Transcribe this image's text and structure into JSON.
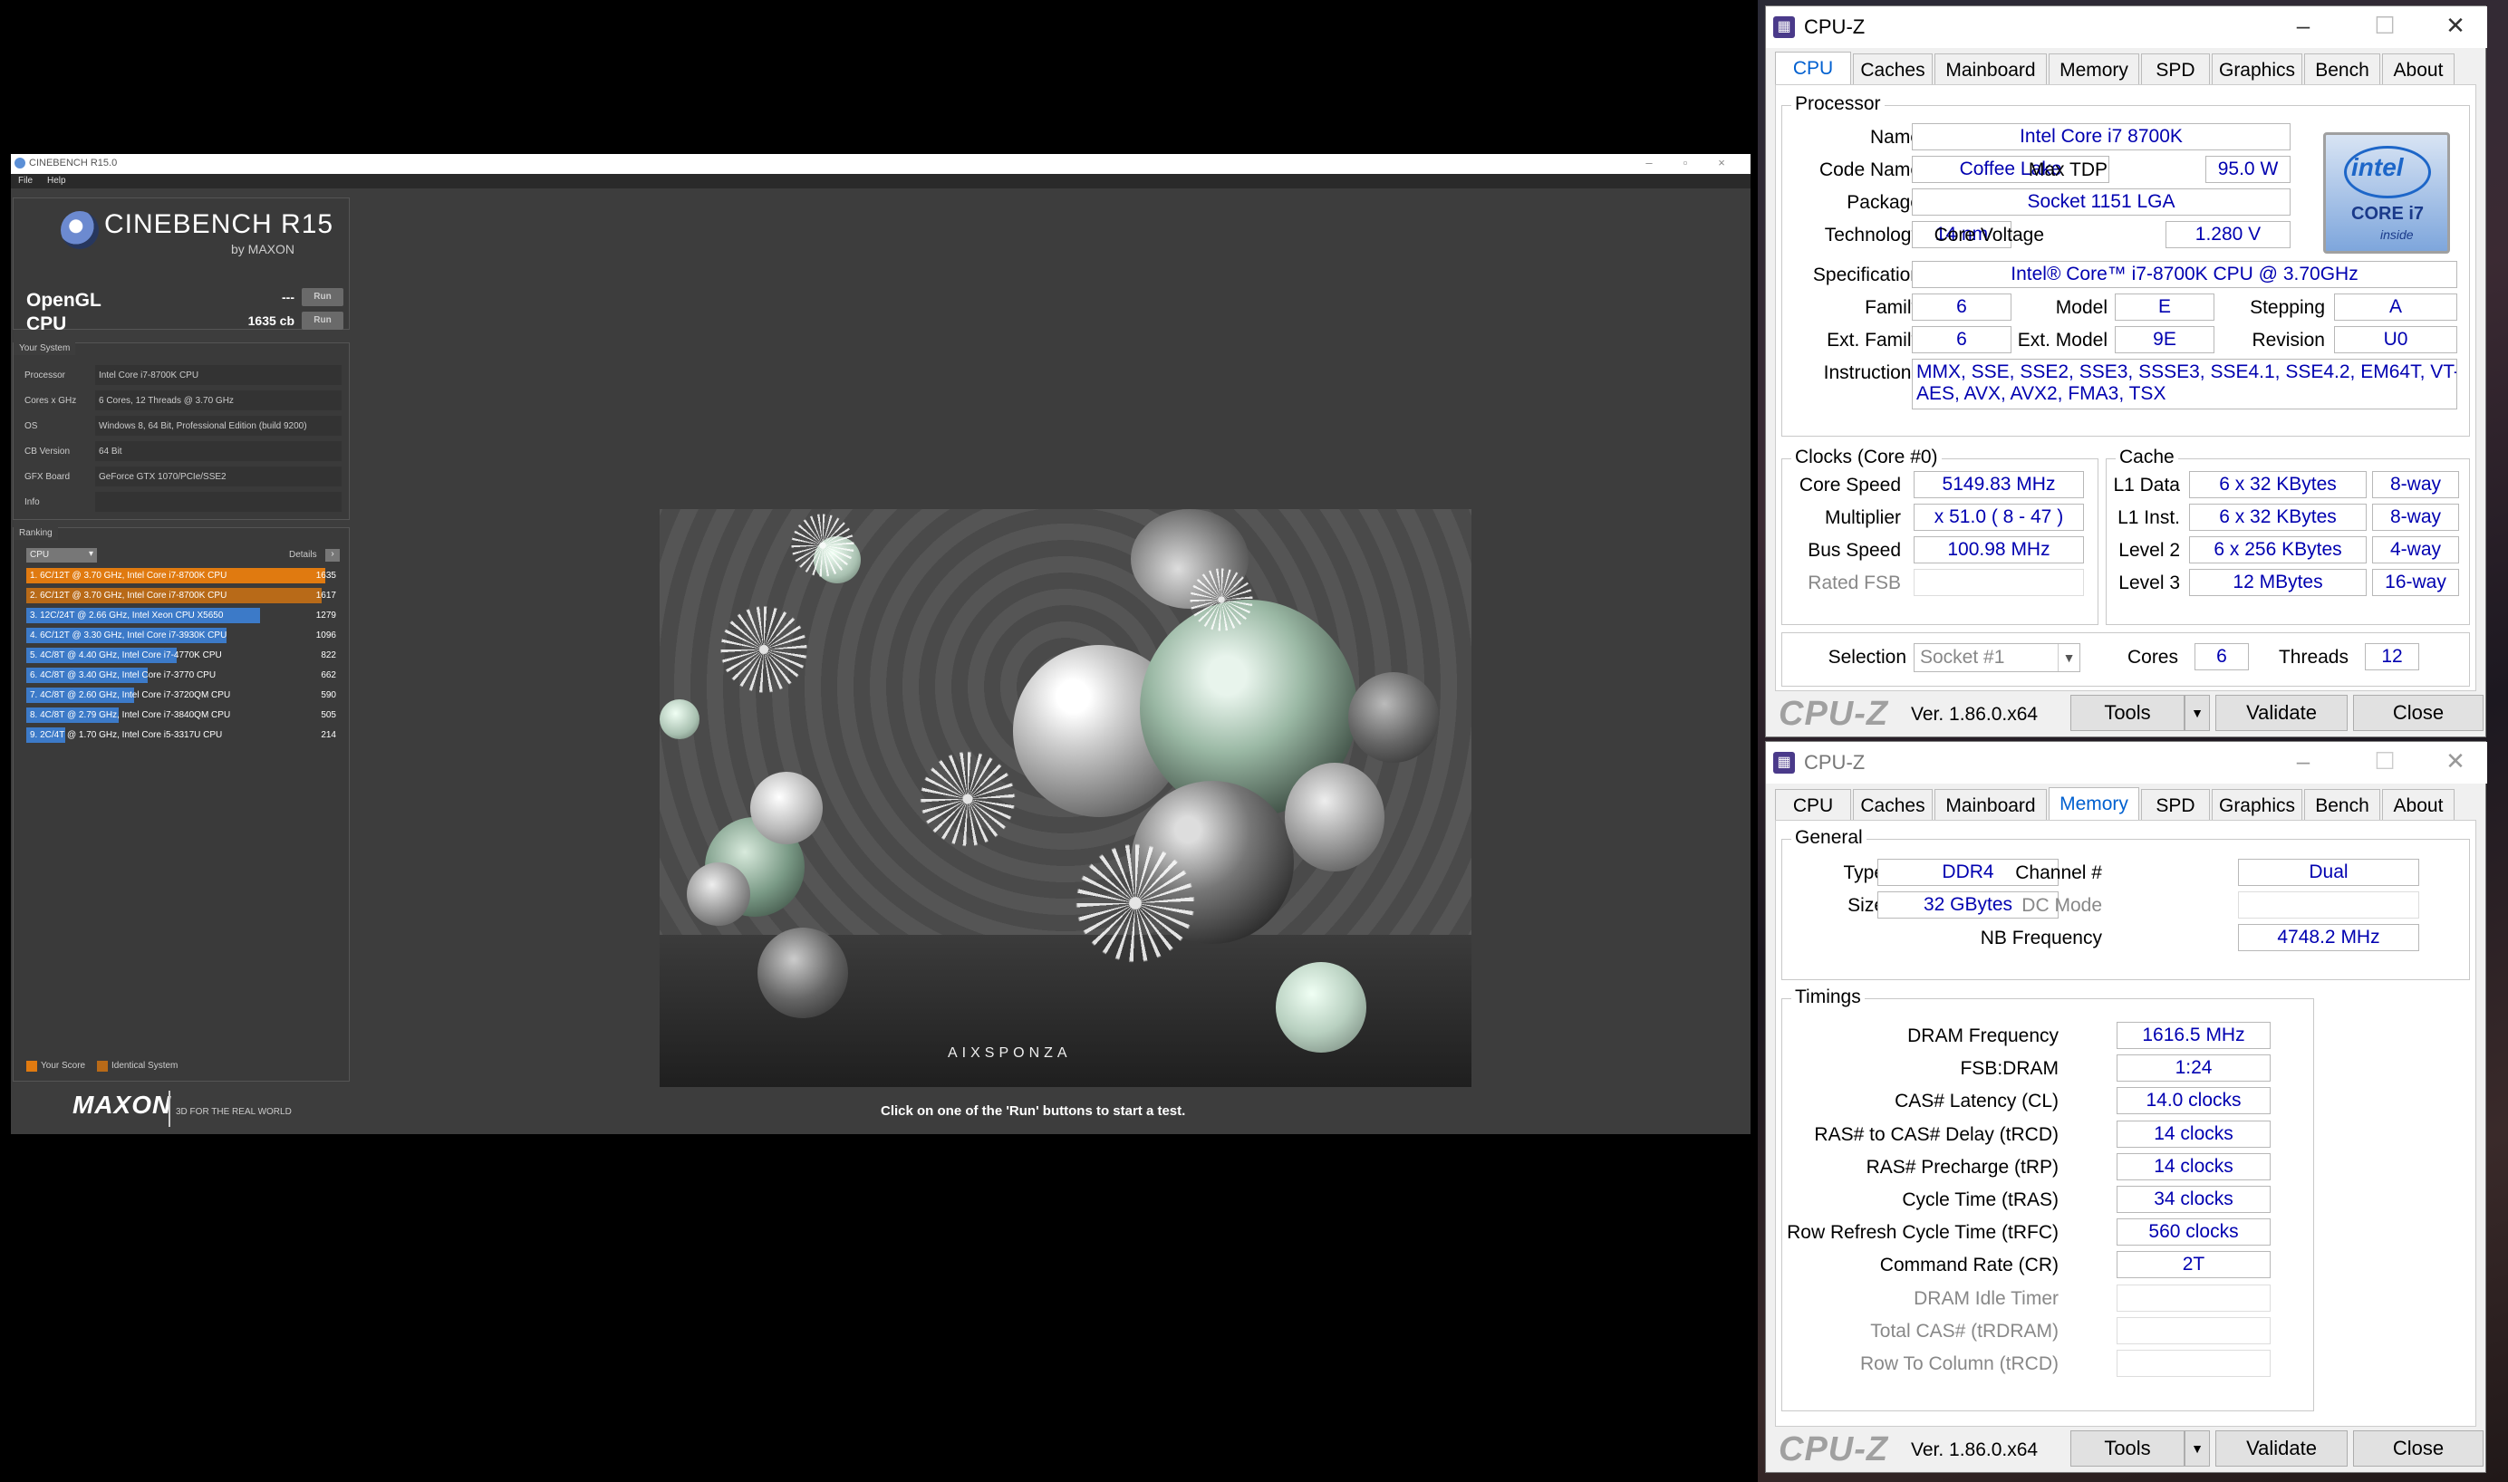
{
  "cinebench": {
    "window_title": "CINEBENCH R15.0",
    "menu": [
      "File",
      "Help"
    ],
    "logo_title": "CINEBENCH R15",
    "logo_sub": "by MAXON",
    "opengl": {
      "label": "OpenGL",
      "value": "---",
      "button": "Run"
    },
    "cpu": {
      "label": "CPU",
      "value": "1635 cb",
      "button": "Run"
    },
    "your_system_header": "Your System",
    "system": [
      {
        "key": "Processor",
        "value": "Intel Core i7-8700K CPU"
      },
      {
        "key": "Cores x GHz",
        "value": "6 Cores, 12 Threads @ 3.70 GHz"
      },
      {
        "key": "OS",
        "value": "Windows 8, 64 Bit, Professional Edition (build 9200)"
      },
      {
        "key": "CB Version",
        "value": "64 Bit"
      },
      {
        "key": "GFX Board",
        "value": "GeForce GTX 1070/PCIe/SSE2"
      },
      {
        "key": "Info",
        "value": ""
      }
    ],
    "ranking_header": "Ranking",
    "ranking_dropdown": "CPU",
    "details_label": "Details",
    "ranking": [
      {
        "label": "1. 6C/12T @ 3.70 GHz, Intel Core i7-8700K CPU",
        "score": 1635,
        "kind": "your"
      },
      {
        "label": "2. 6C/12T @ 3.70 GHz, Intel Core i7-8700K CPU",
        "score": 1617,
        "kind": "identical"
      },
      {
        "label": "3. 12C/24T @ 2.66 GHz, Intel Xeon CPU X5650",
        "score": 1279,
        "kind": "ref"
      },
      {
        "label": "4. 6C/12T @ 3.30 GHz,  Intel Core i7-3930K CPU",
        "score": 1096,
        "kind": "ref"
      },
      {
        "label": "5. 4C/8T @ 4.40 GHz, Intel Core i7-4770K CPU",
        "score": 822,
        "kind": "ref"
      },
      {
        "label": "6. 4C/8T @ 3.40 GHz,  Intel Core i7-3770 CPU",
        "score": 662,
        "kind": "ref"
      },
      {
        "label": "7. 4C/8T @ 2.60 GHz, Intel Core i7-3720QM CPU",
        "score": 590,
        "kind": "ref"
      },
      {
        "label": "8. 4C/8T @ 2.79 GHz,  Intel Core i7-3840QM CPU",
        "score": 505,
        "kind": "ref"
      },
      {
        "label": "9. 2C/4T @ 1.70 GHz,  Intel Core i5-3317U CPU",
        "score": 214,
        "kind": "ref"
      }
    ],
    "legend": {
      "your": "Your Score",
      "identical": "Identical System"
    },
    "maxon": "MAXON",
    "maxon_tag": "3D FOR THE REAL WORLD",
    "status": "Click on one of the 'Run' buttons to start a test.",
    "render_credit": "AIXSPONZA",
    "colors": {
      "your": "#e07a10",
      "identical": "#b86a18",
      "ref": "#3c7ac8"
    }
  },
  "cpuz_cpu": {
    "title": "CPU-Z",
    "tabs": [
      "CPU",
      "Caches",
      "Mainboard",
      "Memory",
      "SPD",
      "Graphics",
      "Bench",
      "About"
    ],
    "active_tab": "CPU",
    "processor_group": "Processor",
    "name_label": "Name",
    "name": "Intel Core i7 8700K",
    "codename_label": "Code Name",
    "codename": "Coffee Lake",
    "maxtdp_label": "Max TDP",
    "maxtdp": "95.0 W",
    "package_label": "Package",
    "package": "Socket 1151 LGA",
    "technology_label": "Technology",
    "technology": "14 nm",
    "corevoltage_label": "Core Voltage",
    "corevoltage": "1.280 V",
    "spec_label": "Specification",
    "spec": "Intel® Core™ i7-8700K CPU @ 3.70GHz",
    "family_label": "Family",
    "family": "6",
    "model_label": "Model",
    "model": "E",
    "stepping_label": "Stepping",
    "stepping": "A",
    "extfamily_label": "Ext. Family",
    "extfamily": "6",
    "extmodel_label": "Ext. Model",
    "extmodel": "9E",
    "revision_label": "Revision",
    "revision": "U0",
    "instructions_label": "Instructions",
    "instructions_1": "MMX, SSE, SSE2, SSE3, SSSE3, SSE4.1, SSE4.2, EM64T, VT-x,",
    "instructions_2": "AES, AVX, AVX2, FMA3, TSX",
    "intel_logo": {
      "word": "intel",
      "line": "CORE i7",
      "inside": "inside"
    },
    "clocks_group": "Clocks (Core #0)",
    "corespeed_label": "Core Speed",
    "corespeed": "5149.83 MHz",
    "multiplier_label": "Multiplier",
    "multiplier": "x 51.0 ( 8 - 47 )",
    "busspeed_label": "Bus Speed",
    "busspeed": "100.98 MHz",
    "ratedfsb_label": "Rated FSB",
    "ratedfsb": "",
    "cache_group": "Cache",
    "l1d_label": "L1 Data",
    "l1d": "6 x 32 KBytes",
    "l1d_way": "8-way",
    "l1i_label": "L1 Inst.",
    "l1i": "6 x 32 KBytes",
    "l1i_way": "8-way",
    "l2_label": "Level 2",
    "l2": "6 x 256 KBytes",
    "l2_way": "4-way",
    "l3_label": "Level 3",
    "l3": "12 MBytes",
    "l3_way": "16-way",
    "selection_label": "Selection",
    "selection": "Socket #1",
    "cores_label": "Cores",
    "cores": "6",
    "threads_label": "Threads",
    "threads": "12",
    "brand": "CPU-Z",
    "version": "Ver. 1.86.0.x64",
    "tools": "Tools",
    "validate": "Validate",
    "close": "Close"
  },
  "cpuz_mem": {
    "title": "CPU-Z",
    "tabs": [
      "CPU",
      "Caches",
      "Mainboard",
      "Memory",
      "SPD",
      "Graphics",
      "Bench",
      "About"
    ],
    "active_tab": "Memory",
    "general_group": "General",
    "type_label": "Type",
    "type": "DDR4",
    "size_label": "Size",
    "size": "32 GBytes",
    "channel_label": "Channel #",
    "channel": "Dual",
    "dcmode_label": "DC Mode",
    "dcmode": "",
    "nbfreq_label": "NB Frequency",
    "nbfreq": "4748.2 MHz",
    "timings_group": "Timings",
    "timings": [
      {
        "label": "DRAM Frequency",
        "value": "1616.5 MHz",
        "dim": false
      },
      {
        "label": "FSB:DRAM",
        "value": "1:24",
        "dim": false
      },
      {
        "label": "CAS# Latency (CL)",
        "value": "14.0 clocks",
        "dim": false
      },
      {
        "label": "RAS# to CAS# Delay (tRCD)",
        "value": "14 clocks",
        "dim": false
      },
      {
        "label": "RAS# Precharge (tRP)",
        "value": "14 clocks",
        "dim": false
      },
      {
        "label": "Cycle Time (tRAS)",
        "value": "34 clocks",
        "dim": false
      },
      {
        "label": "Row Refresh Cycle Time (tRFC)",
        "value": "560 clocks",
        "dim": false
      },
      {
        "label": "Command Rate (CR)",
        "value": "2T",
        "dim": false
      },
      {
        "label": "DRAM Idle Timer",
        "value": "",
        "dim": true
      },
      {
        "label": "Total CAS# (tRDRAM)",
        "value": "",
        "dim": true
      },
      {
        "label": "Row To Column (tRCD)",
        "value": "",
        "dim": true
      }
    ],
    "brand": "CPU-Z",
    "version": "Ver. 1.86.0.x64",
    "tools": "Tools",
    "validate": "Validate",
    "close": "Close"
  }
}
